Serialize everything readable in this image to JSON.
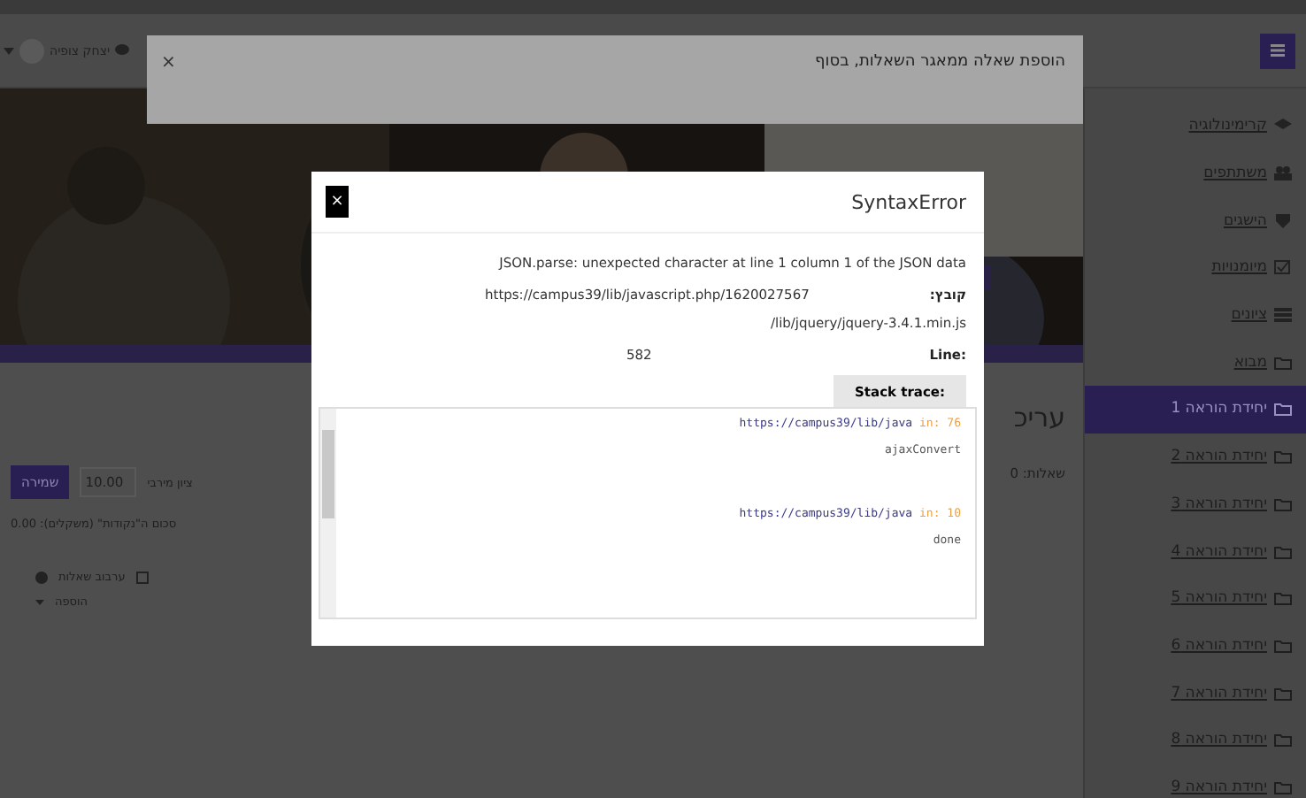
{
  "navbar": {
    "user_name": "יצחק צופיה"
  },
  "toast": {
    "message": "הוספת שאלה ממאגר השאלות, בסוף",
    "close": "×"
  },
  "sidebar": {
    "items": [
      {
        "label": "קרימינולוגיה",
        "kind": "course",
        "selected": false
      },
      {
        "label": "משתתפים",
        "kind": "participants",
        "selected": false
      },
      {
        "label": "הישגים",
        "kind": "badges",
        "selected": false
      },
      {
        "label": "מיומנויות",
        "kind": "competencies",
        "selected": false
      },
      {
        "label": "ציונים",
        "kind": "grades",
        "selected": false
      },
      {
        "label": "מבוא",
        "kind": "section",
        "selected": false
      },
      {
        "label": "יחידת הוראה 1",
        "kind": "section",
        "selected": true
      },
      {
        "label": "יחידת הוראה 2",
        "kind": "section",
        "selected": false
      },
      {
        "label": "יחידת הוראה 3",
        "kind": "section",
        "selected": false
      },
      {
        "label": "יחידת הוראה 4",
        "kind": "section",
        "selected": false
      },
      {
        "label": "יחידת הוראה 5",
        "kind": "section",
        "selected": false
      },
      {
        "label": "יחידת הוראה 6",
        "kind": "section",
        "selected": false
      },
      {
        "label": "יחידת הוראה 7",
        "kind": "section",
        "selected": false
      },
      {
        "label": "יחידת הוראה 8",
        "kind": "section",
        "selected": false
      },
      {
        "label": "יחידת הוראה 9",
        "kind": "section",
        "selected": false
      }
    ]
  },
  "content": {
    "heading": "עריכ",
    "questions": "שאלות: 0",
    "max_grade_label": "ציון מירבי",
    "max_grade": "10.00",
    "save": "שמירה",
    "total": "סכום ה\"נקודות\" (משקלים): 0.00",
    "shuffle": {
      "label": "ערבוב שאלות",
      "checked": false
    },
    "add": "הוספה"
  },
  "modal": {
    "title": "SyntaxError",
    "close": "×",
    "message": "JSON.parse: unexpected character at line 1 column 1 of the JSON data",
    "file_label": "קובץ:",
    "file": "https://campus39/lib/javascript.php/1620027567",
    "file2": "/lib/jquery/jquery-3.4.1.min.js",
    "line_label": "Line:",
    "line": "582",
    "stack_button": "Stack trace:",
    "stack": [
      {
        "url": "https://campus39/lib/java",
        "line": "in: 76",
        "func": "ajaxConvert"
      },
      {
        "url": "https://campus39/lib/java",
        "line": "in: 10",
        "func": "done"
      }
    ]
  }
}
